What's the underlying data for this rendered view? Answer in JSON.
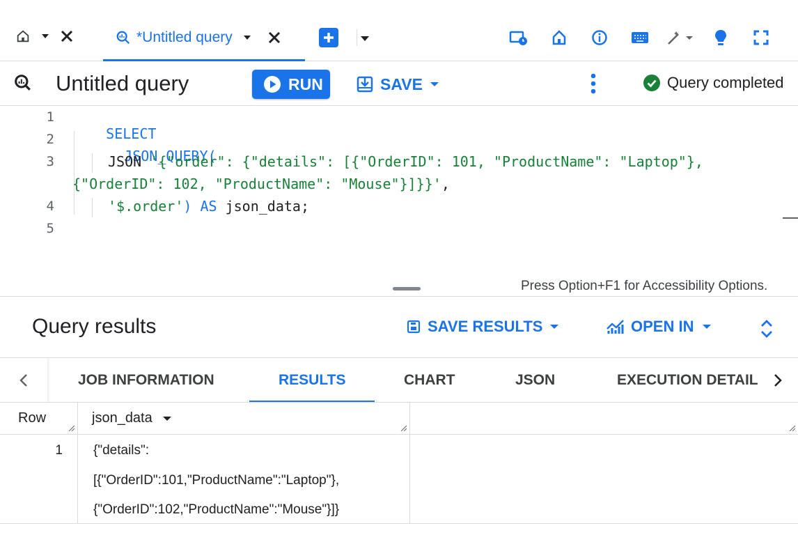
{
  "tabs": {
    "active_label": "*Untitled query"
  },
  "query": {
    "title": "Untitled query",
    "run_label": "RUN",
    "save_label": "SAVE",
    "status": "Query completed"
  },
  "editor": {
    "line_numbers": [
      "1",
      "2",
      "3",
      "4",
      "5"
    ],
    "code": {
      "select": "SELECT",
      "json_query": "JSON_QUERY(",
      "json_kw": "JSON ",
      "json_str_1": "'{\"order\": {\"details\": [{\"OrderID\": 101, \"ProductName\": \"Laptop\"},",
      "json_str_2": "{\"OrderID\": 102, \"ProductName\": \"Mouse\"}]}}'",
      "comma": ",",
      "path_str": "'$.order'",
      "close_paren": ") ",
      "as_kw": "AS",
      "alias": " json_data;"
    },
    "accessibility_hint": "Press Option+F1 for Accessibility Options."
  },
  "results": {
    "title": "Query results",
    "save_results_label": "SAVE RESULTS",
    "open_in_label": "OPEN IN",
    "tabs": [
      "JOB INFORMATION",
      "RESULTS",
      "CHART",
      "JSON",
      "EXECUTION DETAIL"
    ],
    "active_tab": "RESULTS",
    "columns": [
      "Row",
      "json_data"
    ],
    "rows": [
      {
        "row": "1",
        "json_data_lines": [
          "{\"details\":",
          "[{\"OrderID\":101,\"ProductName\":\"Laptop\"},",
          "{\"OrderID\":102,\"ProductName\":\"Mouse\"}]}"
        ]
      }
    ]
  },
  "colors": {
    "accent": "#1a73e8",
    "string": "#188038",
    "success": "#188038"
  }
}
